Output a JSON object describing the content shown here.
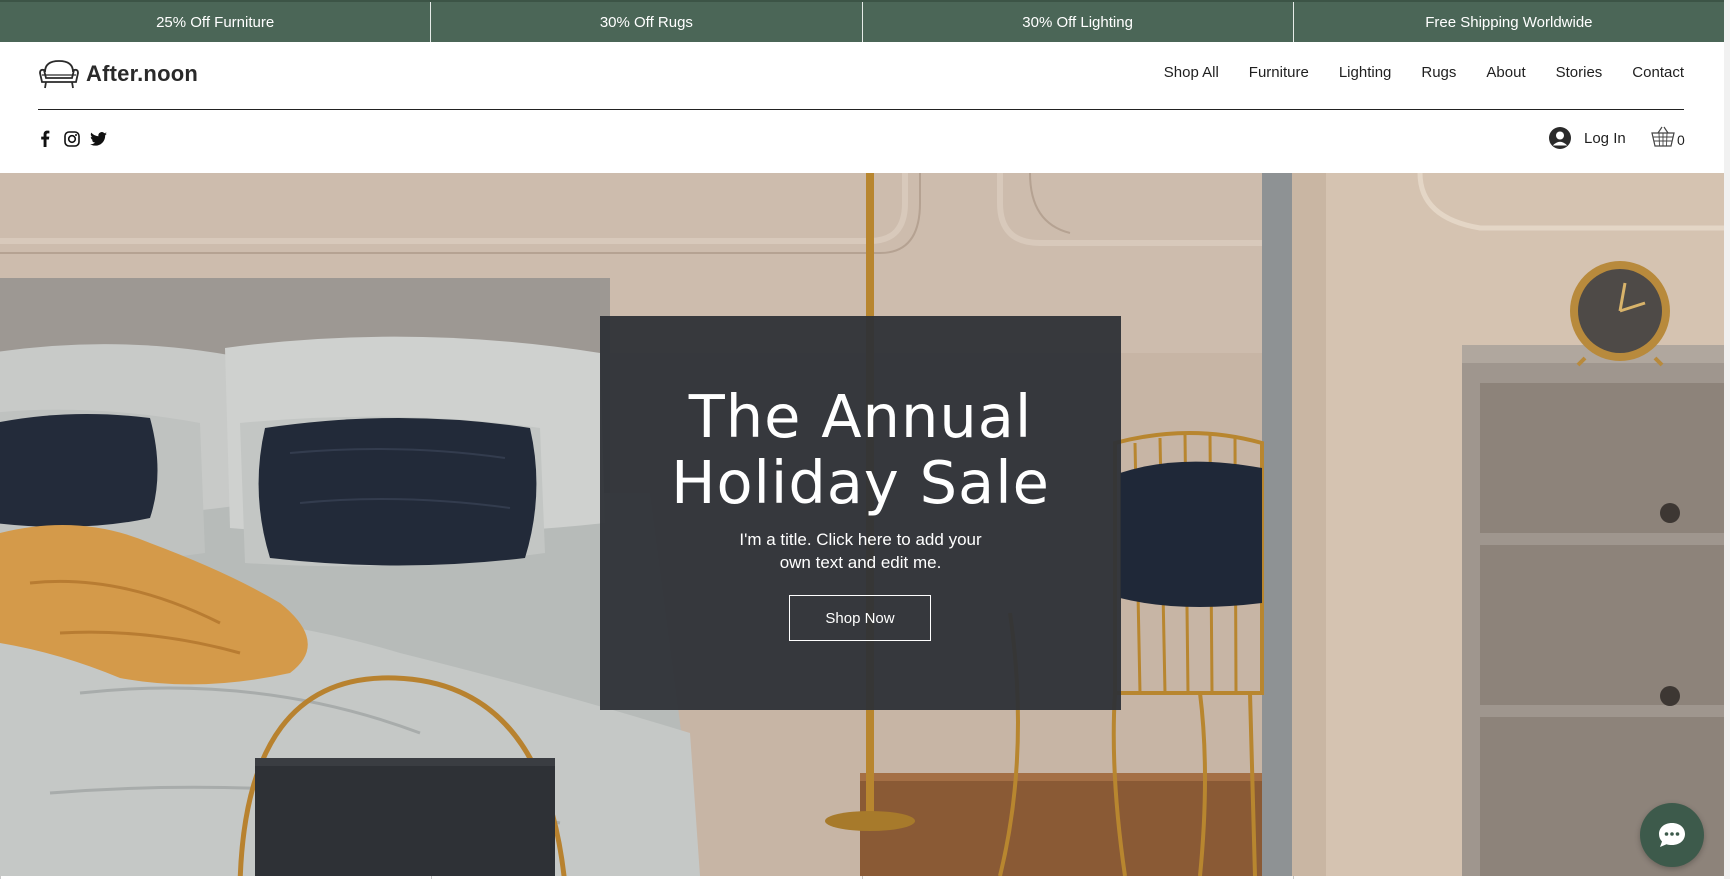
{
  "promo_bar": {
    "items": [
      "25% Off Furniture",
      "30% Off Rugs",
      "30% Off Lighting",
      "Free Shipping Worldwide"
    ]
  },
  "header": {
    "logo_text": "After.noon",
    "nav": [
      "Shop All",
      "Furniture",
      "Lighting",
      "Rugs",
      "About",
      "Stories",
      "Contact"
    ],
    "social_icons": [
      "facebook-icon",
      "instagram-icon",
      "twitter-icon"
    ],
    "login_label": "Log In",
    "cart_count": "0"
  },
  "hero": {
    "title_line1": "The Annual",
    "title_line2": "Holiday Sale",
    "subtitle": "I'm a title. Click here to add your own text and edit me.",
    "button_label": "Shop Now"
  },
  "colors": {
    "promo_bar_bg": "#4b6657",
    "panel_bg": "#2e3237",
    "chat_bg": "#3d5a4b"
  },
  "chat": {
    "icon": "chat-bubble-icon"
  }
}
